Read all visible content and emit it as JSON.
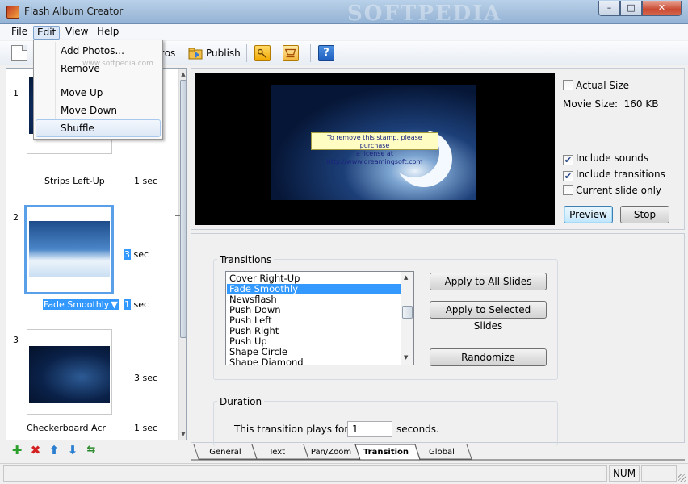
{
  "window": {
    "title": "Flash Album Creator",
    "watermark": "SOFTPEDIA",
    "buttons": {
      "minimize": "–",
      "maximize": "□",
      "close": "✕"
    }
  },
  "menubar": {
    "items": [
      {
        "label": "File"
      },
      {
        "label": "Edit"
      },
      {
        "label": "View"
      },
      {
        "label": "Help"
      }
    ]
  },
  "toolbar": {
    "photos_label_tail": "tos",
    "publish_label": "Publish",
    "help_glyph": "?"
  },
  "edit_menu": {
    "items": [
      {
        "label": "Add Photos..."
      },
      {
        "label": "Remove"
      },
      {
        "label": "Move Up"
      },
      {
        "label": "Move Down"
      },
      {
        "label": "Shuffle"
      }
    ],
    "watermark": "www.softpedia.com"
  },
  "slides": [
    {
      "number": "1",
      "caption": "Strips Left-Up",
      "time": "1 sec"
    },
    {
      "number": "2",
      "slide_time_value": "3",
      "slide_time_unit": " sec",
      "caption": "Fade Smoothly",
      "caption_arrow": "▼",
      "time_value": "1",
      "time_unit": " sec"
    },
    {
      "number": "3",
      "slide_time": "3 sec",
      "caption": "Checkerboard Acr",
      "time": "1 sec"
    }
  ],
  "preview": {
    "stamp_line1": "To remove this stamp, please purchase",
    "stamp_line2": "a license at http://www.dreamingsoft.com",
    "actual_size_label": "Actual Size",
    "movie_size_label": "Movie Size:",
    "movie_size_value": "160 KB",
    "include_sounds_label": "Include sounds",
    "include_transitions_label": "Include transitions",
    "current_slide_only_label": "Current slide only",
    "preview_button": "Preview",
    "stop_button": "Stop",
    "checkmark": "✔"
  },
  "transitions": {
    "group_label": "Transitions",
    "items": [
      "Cover Right-Up",
      "Fade Smoothly",
      "Newsflash",
      "Push Down",
      "Push Left",
      "Push Right",
      "Push Up",
      "Shape Circle",
      "Shape Diamond"
    ],
    "selected": "Fade Smoothly",
    "apply_all_button": "Apply to All Slides",
    "apply_selected_button": "Apply to Selected Slides",
    "randomize_button": "Randomize"
  },
  "duration": {
    "group_label": "Duration",
    "prefix": "This transition plays for",
    "value": "1",
    "suffix": "seconds."
  },
  "tabs": [
    {
      "label": "General"
    },
    {
      "label": "Text"
    },
    {
      "label": "Pan/Zoom"
    },
    {
      "label": "Transition"
    },
    {
      "label": "Global"
    }
  ],
  "statusbar": {
    "num": "NUM"
  }
}
